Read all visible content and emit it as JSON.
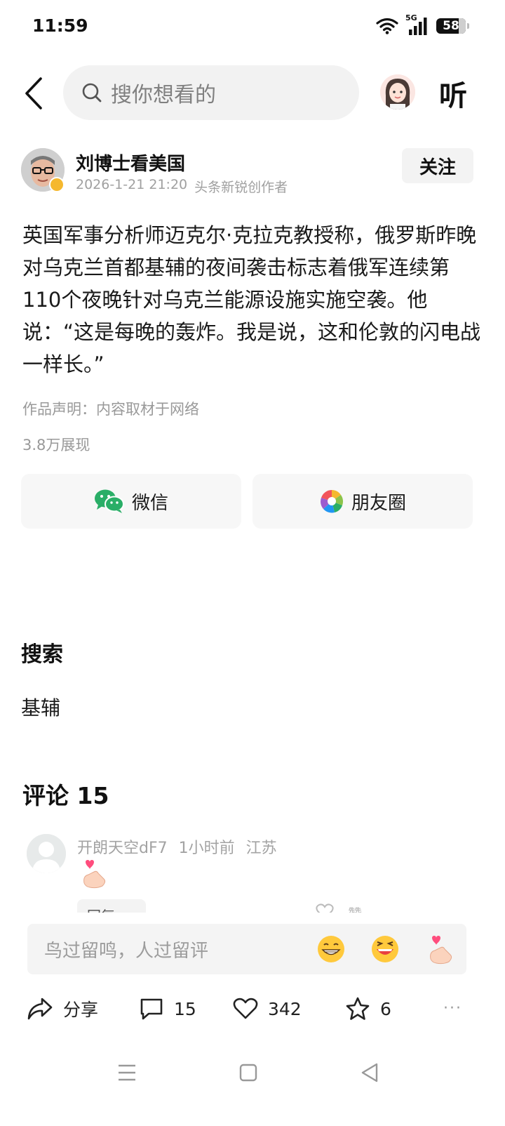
{
  "status_bar": {
    "time": "11:59",
    "network": "5G",
    "battery": "58"
  },
  "top_bar": {
    "search_placeholder": "搜你想看的",
    "listen_label": "听"
  },
  "author": {
    "name": "刘博士看美国",
    "date": "2026-1-21 21:20",
    "tag": "头条新锐创作者",
    "follow_label": "关注"
  },
  "article": {
    "body": "英国军事分析师迈克尔·克拉克教授称，俄罗斯昨晚对乌克兰首都基辅的夜间袭击标志着俄军连续第110个夜晚针对乌克兰能源设施实施空袭。他说：“这是每晚的轰炸。我是说，这和伦敦的闪电战一样长。”",
    "declaration": "作品声明：内容取材于网络",
    "views": "3.8万展现"
  },
  "share": {
    "wechat_label": "微信",
    "moments_label": "朋友圈"
  },
  "search_section": {
    "title": "搜索",
    "term": "基辅"
  },
  "comments": {
    "title": "评论 15",
    "items": [
      {
        "user": "开朗天空dF7",
        "time": "1小时前",
        "location": "江苏",
        "reply_label": "回复 ›",
        "like_label": "赞"
      }
    ]
  },
  "comment_input": {
    "placeholder": "鸟过留鸣，人过留评"
  },
  "action_bar": {
    "share_label": "分享",
    "comment_count": "15",
    "like_count": "342",
    "favorite_count": "6",
    "more": "···"
  },
  "colors": {
    "wechat_green": "#2aae67",
    "badge_gold": "#f5b82e",
    "heart_pink": "#ff4d7d"
  }
}
